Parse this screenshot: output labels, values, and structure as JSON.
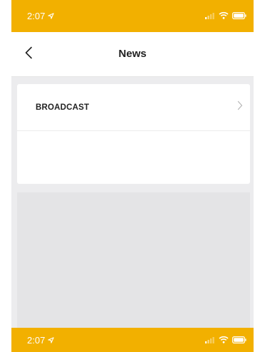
{
  "status_bar": {
    "time": "2:07",
    "location_icon": "location-arrow-icon",
    "signal_icon": "signal-icon",
    "wifi_icon": "wifi-icon",
    "battery_icon": "battery-icon"
  },
  "bottom_status_bar": {
    "time": "2:07"
  },
  "nav": {
    "title": "News",
    "back_icon": "chevron-left-icon"
  },
  "list": {
    "items": [
      {
        "label": "BROADCAST",
        "icon": "chevron-right-icon"
      }
    ]
  },
  "colors": {
    "accent": "#f2b000",
    "background": "#ececee",
    "card": "#ffffff",
    "text": "#222222"
  }
}
